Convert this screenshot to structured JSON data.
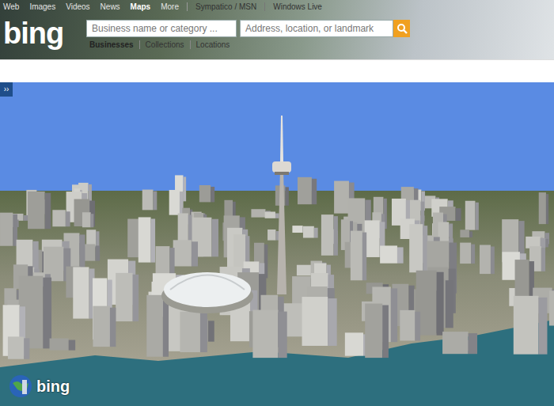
{
  "nav": [
    {
      "label": "Web",
      "selected": false
    },
    {
      "label": "Images",
      "selected": false
    },
    {
      "label": "Videos",
      "selected": false
    },
    {
      "label": "News",
      "selected": false
    },
    {
      "label": "Maps",
      "selected": true
    },
    {
      "label": "More",
      "selected": false
    }
  ],
  "partner_links": [
    "Sympatico / MSN",
    "Windows Live"
  ],
  "logo": "bing",
  "search": {
    "business_placeholder": "Business name or category ...",
    "location_placeholder": "Address, location, or landmark"
  },
  "search_tabs": [
    {
      "label": "Businesses",
      "selected": true
    },
    {
      "label": "Collections",
      "selected": false
    },
    {
      "label": "Locations",
      "selected": false
    }
  ],
  "panel_toggle": "››",
  "map": {
    "watermark": "bing"
  }
}
